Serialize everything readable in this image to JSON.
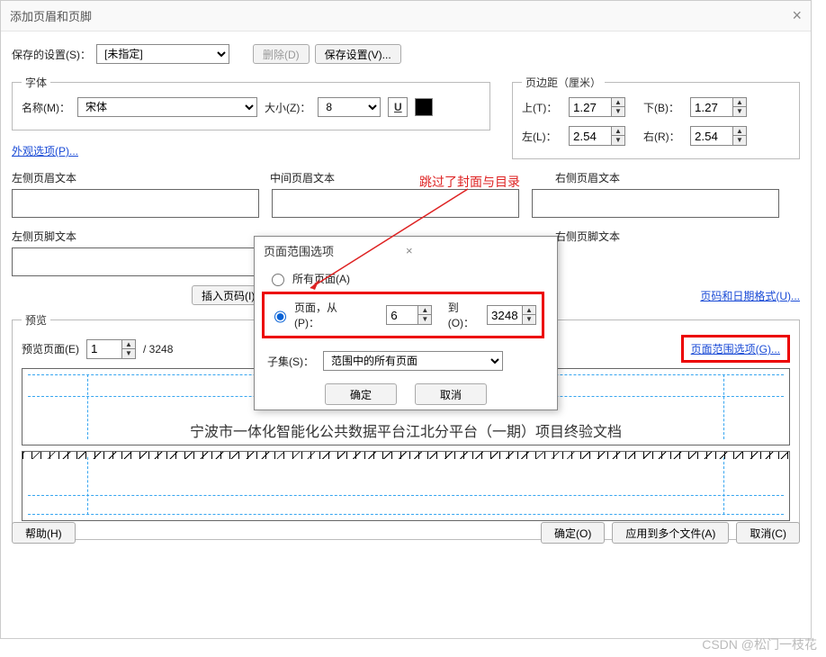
{
  "window": {
    "title": "添加页眉和页脚"
  },
  "saved": {
    "label": "保存的设置(S)：",
    "value": "[未指定]",
    "delete": "删除(D)",
    "save": "保存设置(V)..."
  },
  "font_group": {
    "legend": "字体",
    "name_label": "名称(M)：",
    "name_value": "宋体",
    "size_label": "大小(Z)：",
    "size_value": "8",
    "underline": "U"
  },
  "appearance_link": "外观选项(P)...",
  "margins": {
    "legend": "页边距（厘米）",
    "top_l": "上(T)：",
    "top_v": "1.27",
    "bottom_l": "下(B)：",
    "bottom_v": "1.27",
    "left_l": "左(L)：",
    "left_v": "2.54",
    "right_l": "右(R)：",
    "right_v": "2.54"
  },
  "hf": {
    "lh": "左侧页眉文本",
    "ch": "中间页眉文本",
    "rh": "右侧页眉文本",
    "lf": "左侧页脚文本",
    "rf": "右侧页脚文本",
    "insert": "插入页码(I)",
    "format_link": "页码和日期格式(U)...",
    "range_link": "页面范围选项(G)..."
  },
  "preview": {
    "legend": "预览",
    "page_label": "预览页面(E)",
    "page_value": "1",
    "total": "/ 3248",
    "sample_text": "宁波市一体化智能化公共数据平台江北分平台（一期）项目终验文档"
  },
  "modal": {
    "title": "页面范围选项",
    "all": "所有页面(A)",
    "pages_label": "页面，从(P)：",
    "from": "6",
    "to_label": "到(O)：",
    "to": "3248",
    "subset_label": "子集(S)：",
    "subset_value": "范围中的所有页面",
    "ok": "确定",
    "cancel": "取消"
  },
  "footer": {
    "help": "帮助(H)",
    "ok": "确定(O)",
    "apply": "应用到多个文件(A)",
    "cancel": "取消(C)"
  },
  "annot": "跳过了封面与目录",
  "watermark": "CSDN @松门一枝花"
}
